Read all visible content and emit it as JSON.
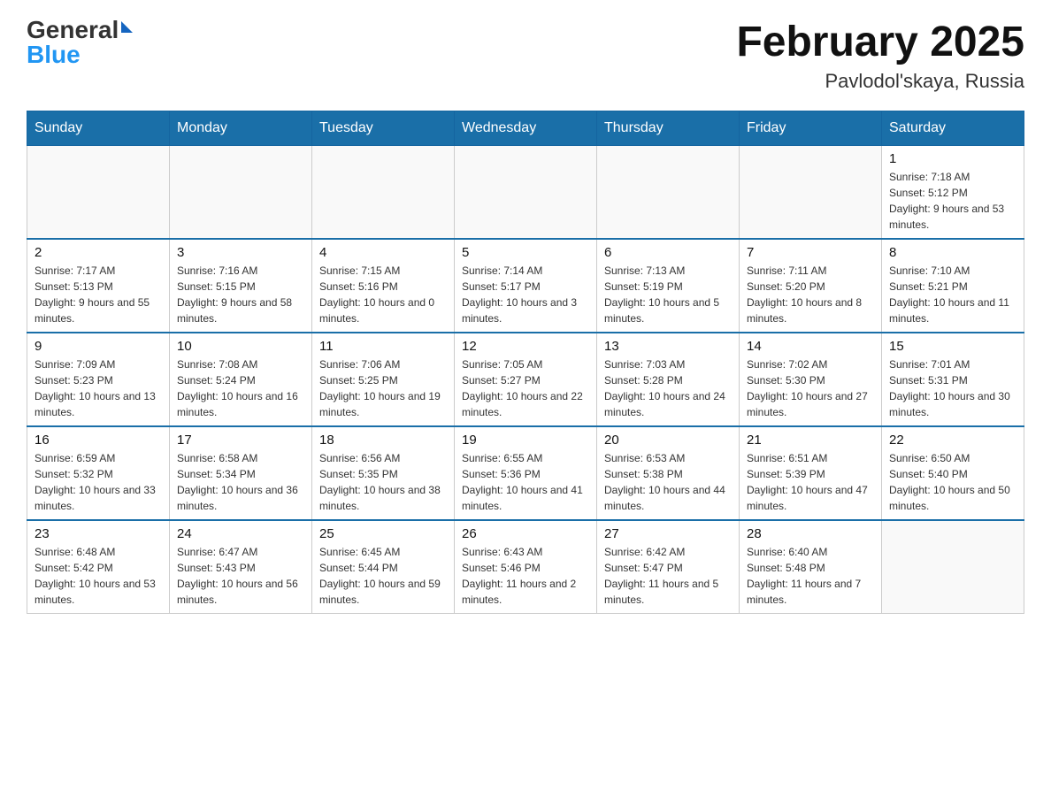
{
  "header": {
    "month_title": "February 2025",
    "location": "Pavlodol'skaya, Russia"
  },
  "days_of_week": [
    "Sunday",
    "Monday",
    "Tuesday",
    "Wednesday",
    "Thursday",
    "Friday",
    "Saturday"
  ],
  "weeks": [
    {
      "days": [
        {
          "number": "",
          "info": ""
        },
        {
          "number": "",
          "info": ""
        },
        {
          "number": "",
          "info": ""
        },
        {
          "number": "",
          "info": ""
        },
        {
          "number": "",
          "info": ""
        },
        {
          "number": "",
          "info": ""
        },
        {
          "number": "1",
          "info": "Sunrise: 7:18 AM\nSunset: 5:12 PM\nDaylight: 9 hours and 53 minutes."
        }
      ]
    },
    {
      "days": [
        {
          "number": "2",
          "info": "Sunrise: 7:17 AM\nSunset: 5:13 PM\nDaylight: 9 hours and 55 minutes."
        },
        {
          "number": "3",
          "info": "Sunrise: 7:16 AM\nSunset: 5:15 PM\nDaylight: 9 hours and 58 minutes."
        },
        {
          "number": "4",
          "info": "Sunrise: 7:15 AM\nSunset: 5:16 PM\nDaylight: 10 hours and 0 minutes."
        },
        {
          "number": "5",
          "info": "Sunrise: 7:14 AM\nSunset: 5:17 PM\nDaylight: 10 hours and 3 minutes."
        },
        {
          "number": "6",
          "info": "Sunrise: 7:13 AM\nSunset: 5:19 PM\nDaylight: 10 hours and 5 minutes."
        },
        {
          "number": "7",
          "info": "Sunrise: 7:11 AM\nSunset: 5:20 PM\nDaylight: 10 hours and 8 minutes."
        },
        {
          "number": "8",
          "info": "Sunrise: 7:10 AM\nSunset: 5:21 PM\nDaylight: 10 hours and 11 minutes."
        }
      ]
    },
    {
      "days": [
        {
          "number": "9",
          "info": "Sunrise: 7:09 AM\nSunset: 5:23 PM\nDaylight: 10 hours and 13 minutes."
        },
        {
          "number": "10",
          "info": "Sunrise: 7:08 AM\nSunset: 5:24 PM\nDaylight: 10 hours and 16 minutes."
        },
        {
          "number": "11",
          "info": "Sunrise: 7:06 AM\nSunset: 5:25 PM\nDaylight: 10 hours and 19 minutes."
        },
        {
          "number": "12",
          "info": "Sunrise: 7:05 AM\nSunset: 5:27 PM\nDaylight: 10 hours and 22 minutes."
        },
        {
          "number": "13",
          "info": "Sunrise: 7:03 AM\nSunset: 5:28 PM\nDaylight: 10 hours and 24 minutes."
        },
        {
          "number": "14",
          "info": "Sunrise: 7:02 AM\nSunset: 5:30 PM\nDaylight: 10 hours and 27 minutes."
        },
        {
          "number": "15",
          "info": "Sunrise: 7:01 AM\nSunset: 5:31 PM\nDaylight: 10 hours and 30 minutes."
        }
      ]
    },
    {
      "days": [
        {
          "number": "16",
          "info": "Sunrise: 6:59 AM\nSunset: 5:32 PM\nDaylight: 10 hours and 33 minutes."
        },
        {
          "number": "17",
          "info": "Sunrise: 6:58 AM\nSunset: 5:34 PM\nDaylight: 10 hours and 36 minutes."
        },
        {
          "number": "18",
          "info": "Sunrise: 6:56 AM\nSunset: 5:35 PM\nDaylight: 10 hours and 38 minutes."
        },
        {
          "number": "19",
          "info": "Sunrise: 6:55 AM\nSunset: 5:36 PM\nDaylight: 10 hours and 41 minutes."
        },
        {
          "number": "20",
          "info": "Sunrise: 6:53 AM\nSunset: 5:38 PM\nDaylight: 10 hours and 44 minutes."
        },
        {
          "number": "21",
          "info": "Sunrise: 6:51 AM\nSunset: 5:39 PM\nDaylight: 10 hours and 47 minutes."
        },
        {
          "number": "22",
          "info": "Sunrise: 6:50 AM\nSunset: 5:40 PM\nDaylight: 10 hours and 50 minutes."
        }
      ]
    },
    {
      "days": [
        {
          "number": "23",
          "info": "Sunrise: 6:48 AM\nSunset: 5:42 PM\nDaylight: 10 hours and 53 minutes."
        },
        {
          "number": "24",
          "info": "Sunrise: 6:47 AM\nSunset: 5:43 PM\nDaylight: 10 hours and 56 minutes."
        },
        {
          "number": "25",
          "info": "Sunrise: 6:45 AM\nSunset: 5:44 PM\nDaylight: 10 hours and 59 minutes."
        },
        {
          "number": "26",
          "info": "Sunrise: 6:43 AM\nSunset: 5:46 PM\nDaylight: 11 hours and 2 minutes."
        },
        {
          "number": "27",
          "info": "Sunrise: 6:42 AM\nSunset: 5:47 PM\nDaylight: 11 hours and 5 minutes."
        },
        {
          "number": "28",
          "info": "Sunrise: 6:40 AM\nSunset: 5:48 PM\nDaylight: 11 hours and 7 minutes."
        },
        {
          "number": "",
          "info": ""
        }
      ]
    }
  ]
}
